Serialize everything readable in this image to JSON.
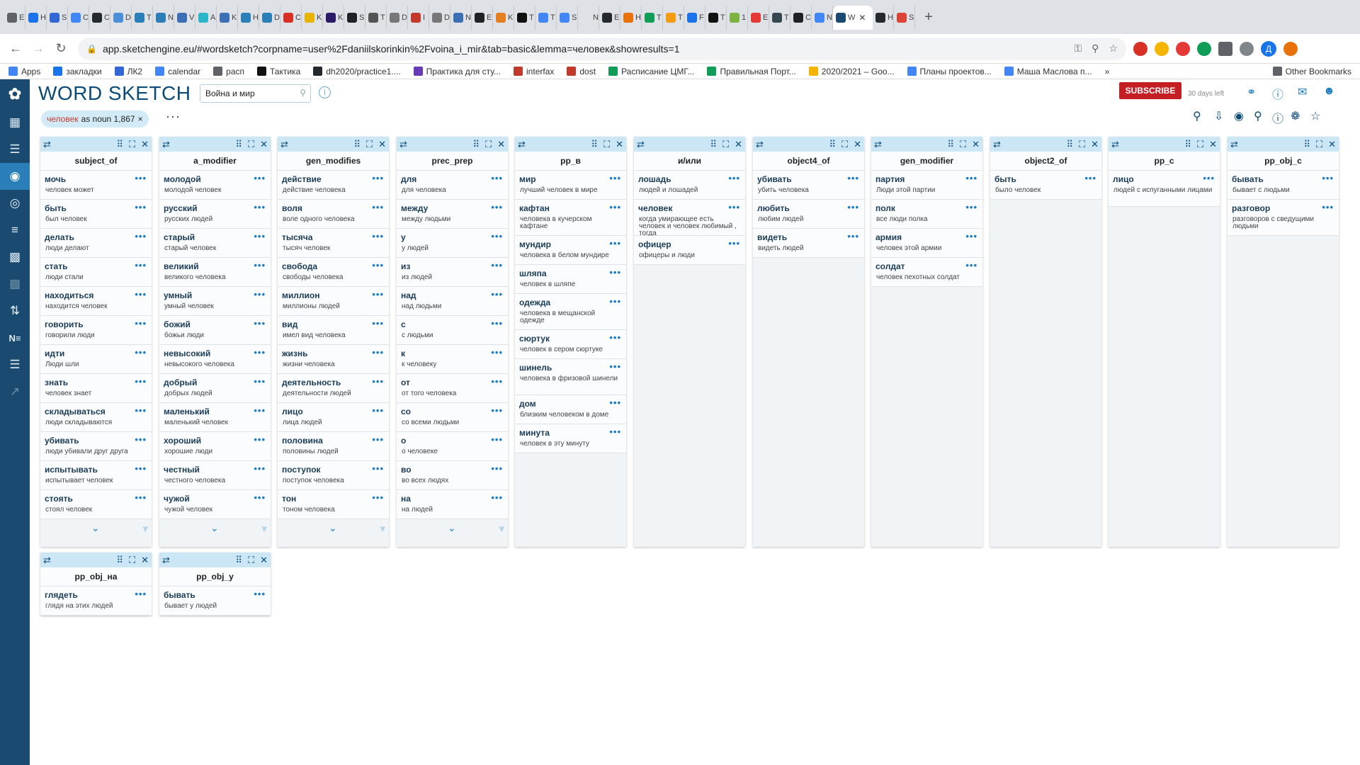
{
  "browser": {
    "tabs": [
      {
        "title": "E",
        "color": "#5f6368"
      },
      {
        "title": "H",
        "color": "#1a73e8"
      },
      {
        "title": "S",
        "color": "#3367d6"
      },
      {
        "title": "C",
        "color": "#4285f4"
      },
      {
        "title": "C",
        "color": "#24292e"
      },
      {
        "title": "D",
        "color": "#4a90d9"
      },
      {
        "title": "T",
        "color": "#2a7fb8"
      },
      {
        "title": "N",
        "color": "#2a7fb8"
      },
      {
        "title": "V",
        "color": "#3d6fb4"
      },
      {
        "title": "A",
        "color": "#2bb5c9"
      },
      {
        "title": "K",
        "color": "#3d6fb4"
      },
      {
        "title": "H",
        "color": "#2a7fb8"
      },
      {
        "title": "D",
        "color": "#2a7fb8"
      },
      {
        "title": "C",
        "color": "#d93025"
      },
      {
        "title": "K",
        "color": "#e8b400"
      },
      {
        "title": "K",
        "color": "#2d1b69"
      },
      {
        "title": "S",
        "color": "#202124"
      },
      {
        "title": "T",
        "color": "#555555"
      },
      {
        "title": "D",
        "color": "#777777"
      },
      {
        "title": "I",
        "color": "#c0392b"
      },
      {
        "title": "D",
        "color": "#777777"
      },
      {
        "title": "N",
        "color": "#3d6fb4"
      },
      {
        "title": "E",
        "color": "#202124"
      },
      {
        "title": "K",
        "color": "#e67e22"
      },
      {
        "title": "T",
        "color": "#111111"
      },
      {
        "title": "T",
        "color": "#4285f4"
      },
      {
        "title": "S",
        "color": "#4285f4"
      },
      {
        "title": "New",
        "color": "#dee1e6"
      },
      {
        "title": "E",
        "color": "#24292e"
      },
      {
        "title": "H",
        "color": "#e8710a"
      },
      {
        "title": "T",
        "color": "#0f9d58"
      },
      {
        "title": "T",
        "color": "#f39c12"
      },
      {
        "title": "F",
        "color": "#1a73e8"
      },
      {
        "title": "T",
        "color": "#111111"
      },
      {
        "title": "1",
        "color": "#7cb342"
      },
      {
        "title": "E",
        "color": "#e53935"
      },
      {
        "title": "T",
        "color": "#37474f"
      },
      {
        "title": "C",
        "color": "#202124"
      },
      {
        "title": "N",
        "color": "#4285f4"
      },
      {
        "title": "W",
        "color": "#1a4a70"
      },
      {
        "title": "H",
        "color": "#24292e"
      },
      {
        "title": "S",
        "color": "#db4437"
      }
    ],
    "active_tab_index": 39,
    "url": "app.sketchengine.eu/#wordsketch?corpname=user%2Fdaniilskorinkin%2Fvoina_i_mir&tab=basic&lemma=человек&showresults=1",
    "profile_initial": "Д",
    "bookmarks": [
      {
        "label": "Apps",
        "color": "#4285f4"
      },
      {
        "label": "закладки",
        "color": "#1a73e8"
      },
      {
        "label": "ЛК2",
        "color": "#3367d6"
      },
      {
        "label": "calendar",
        "color": "#4285f4"
      },
      {
        "label": "расп",
        "color": "#5f6368"
      },
      {
        "label": "Тактика",
        "color": "#111111"
      },
      {
        "label": "dh2020/practice1....",
        "color": "#24292e"
      },
      {
        "label": "Практика для сту...",
        "color": "#673ab7"
      },
      {
        "label": "interfax",
        "color": "#c0392b"
      },
      {
        "label": "dost",
        "color": "#c0392b"
      },
      {
        "label": "Расписание ЦМГ...",
        "color": "#0f9d58"
      },
      {
        "label": "Правильная Порт...",
        "color": "#0f9d58"
      },
      {
        "label": "2020/2021 – Goo...",
        "color": "#f4b400"
      },
      {
        "label": "Планы проектов...",
        "color": "#4285f4"
      },
      {
        "label": "Маша Маслова п...",
        "color": "#4285f4"
      }
    ],
    "bookmarks_overflow": "»",
    "other_bookmarks": "Other Bookmarks"
  },
  "app": {
    "title": "WORD SKETCH",
    "corpus": "Война и мир",
    "subscribe_label": "SUBSCRIBE",
    "days_left": "30 days left",
    "query_chip": {
      "lemma": "человек",
      "rest": "as noun 1,867",
      "close": "×"
    },
    "more_label": "···",
    "accent": "#1a4a70",
    "header_color": "#cbe7f5"
  },
  "columns": [
    {
      "title": "subject_of",
      "has_footer": true,
      "rows": [
        {
          "word": "мочь",
          "example": "человек может"
        },
        {
          "word": "быть",
          "example": "был человек"
        },
        {
          "word": "делать",
          "example": "люди делают"
        },
        {
          "word": "стать",
          "example": "люди стали"
        },
        {
          "word": "находиться",
          "example": "находится человек"
        },
        {
          "word": "говорить",
          "example": "говорили люди"
        },
        {
          "word": "идти",
          "example": "Люди шли"
        },
        {
          "word": "знать",
          "example": "человек знает"
        },
        {
          "word": "складываться",
          "example": "люди складываются"
        },
        {
          "word": "убивать",
          "example": "люди убивали друг друга"
        },
        {
          "word": "испытывать",
          "example": "испытывает человек"
        },
        {
          "word": "стоять",
          "example": "стоял человек"
        }
      ]
    },
    {
      "title": "a_modifier",
      "has_footer": true,
      "rows": [
        {
          "word": "молодой",
          "example": "молодой человек"
        },
        {
          "word": "русский",
          "example": "русских людей"
        },
        {
          "word": "старый",
          "example": "старый человек"
        },
        {
          "word": "великий",
          "example": "великого человека"
        },
        {
          "word": "умный",
          "example": "умный человек"
        },
        {
          "word": "божий",
          "example": "божьи люди"
        },
        {
          "word": "невысокий",
          "example": "невысокого человека"
        },
        {
          "word": "добрый",
          "example": "добрых людей"
        },
        {
          "word": "маленький",
          "example": "маленький человек"
        },
        {
          "word": "хороший",
          "example": "хорошие люди"
        },
        {
          "word": "честный",
          "example": "честного человека"
        },
        {
          "word": "чужой",
          "example": "чужой человек"
        }
      ]
    },
    {
      "title": "gen_modifies",
      "has_footer": true,
      "rows": [
        {
          "word": "действие",
          "example": "действие человека"
        },
        {
          "word": "воля",
          "example": "воле одного человека"
        },
        {
          "word": "тысяча",
          "example": "тысяч человек"
        },
        {
          "word": "свобода",
          "example": "свободы человека"
        },
        {
          "word": "миллион",
          "example": "миллионы людей"
        },
        {
          "word": "вид",
          "example": "имел вид человека"
        },
        {
          "word": "жизнь",
          "example": "жизни человека"
        },
        {
          "word": "деятельность",
          "example": "деятельности людей"
        },
        {
          "word": "лицо",
          "example": "лица людей"
        },
        {
          "word": "половина",
          "example": "половины людей"
        },
        {
          "word": "поступок",
          "example": "поступок человека"
        },
        {
          "word": "тон",
          "example": "тоном человека"
        }
      ]
    },
    {
      "title": "prec_prep",
      "has_footer": true,
      "rows": [
        {
          "word": "для",
          "example": "для человека"
        },
        {
          "word": "между",
          "example": "между людьми"
        },
        {
          "word": "у",
          "example": "у людей"
        },
        {
          "word": "из",
          "example": "из людей"
        },
        {
          "word": "над",
          "example": "над людьми"
        },
        {
          "word": "с",
          "example": "с людьми"
        },
        {
          "word": "к",
          "example": "к человеку"
        },
        {
          "word": "от",
          "example": "от того человека"
        },
        {
          "word": "со",
          "example": "со всеми людьми"
        },
        {
          "word": "о",
          "example": "о человеке"
        },
        {
          "word": "во",
          "example": "во всех людях"
        },
        {
          "word": "на",
          "example": "на людей"
        }
      ]
    },
    {
      "title": "pp_в",
      "has_footer": false,
      "rows": [
        {
          "word": "мир",
          "example": "лучший человек в мире"
        },
        {
          "word": "кафтан",
          "example": "человека в кучерском кафтане",
          "tall": true
        },
        {
          "word": "мундир",
          "example": "человека в белом мундире"
        },
        {
          "word": "шляпа",
          "example": "человек в шляпе"
        },
        {
          "word": "одежда",
          "example": "человека в мещанской одежде",
          "tall": true
        },
        {
          "word": "сюртук",
          "example": "человек в сером сюртуке"
        },
        {
          "word": "шинель",
          "example": "человека в фризовой шинели",
          "tall": true
        },
        {
          "word": "дом",
          "example": "близким человеком в доме"
        },
        {
          "word": "минута",
          "example": "человек в эту минуту"
        }
      ]
    },
    {
      "title": "и/или",
      "has_footer": false,
      "rows": [
        {
          "word": "лошадь",
          "example": "людей и лошадей"
        },
        {
          "word": "человек",
          "example": "когда умирающее есть человек и человек любимый , тогда",
          "tall": true
        },
        {
          "word": "офицер",
          "example": "офицеры и люди"
        }
      ]
    },
    {
      "title": "object4_of",
      "has_footer": false,
      "rows": [
        {
          "word": "убивать",
          "example": "убить человека"
        },
        {
          "word": "любить",
          "example": "любим людей"
        },
        {
          "word": "видеть",
          "example": "видеть людей"
        }
      ]
    },
    {
      "title": "gen_modifier",
      "has_footer": false,
      "rows": [
        {
          "word": "партия",
          "example": "Люди этой партии"
        },
        {
          "word": "полк",
          "example": "все люди полка"
        },
        {
          "word": "армия",
          "example": "человек этой армии"
        },
        {
          "word": "солдат",
          "example": "человек пехотных солдат"
        }
      ]
    },
    {
      "title": "object2_of",
      "has_footer": false,
      "rows": [
        {
          "word": "быть",
          "example": "было человек"
        }
      ]
    },
    {
      "title": "pp_с",
      "has_footer": false,
      "rows": [
        {
          "word": "лицо",
          "example": "людей с испуганными лицами",
          "tall": true
        }
      ]
    },
    {
      "title": "pp_obj_с",
      "has_footer": false,
      "rows": [
        {
          "word": "бывать",
          "example": "бывает с людьми"
        },
        {
          "word": "разговор",
          "example": "разговоров с сведущими людьми",
          "tall": true
        }
      ]
    },
    {
      "title": "pp_obj_на",
      "has_footer": false,
      "rows": [
        {
          "word": "глядеть",
          "example": "глядя на этих людей"
        }
      ]
    },
    {
      "title": "pp_obj_у",
      "has_footer": false,
      "rows": [
        {
          "word": "бывать",
          "example": "бывает у людей"
        }
      ]
    }
  ]
}
